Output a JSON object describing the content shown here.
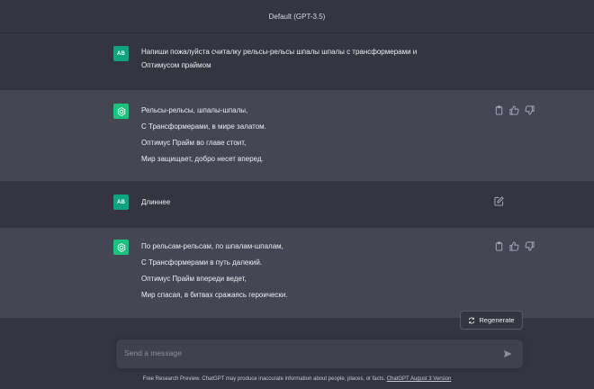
{
  "header": {
    "model_label": "Default (GPT-3.5)"
  },
  "conversation": [
    {
      "role": "user",
      "avatar": "AB",
      "lines": [
        "Напиши пожалуйста считалку рельсы-рельсы шпалы шпалы с трансформерами и",
        "Оптимусом праймом"
      ]
    },
    {
      "role": "assistant",
      "lines": [
        "Рельсы-рельсы, шпалы-шпалы,",
        "С Трансформерами, в мире залатом.",
        "Оптимус Прайм во главе стоит,",
        "Мир защищает, добро несет вперед."
      ]
    },
    {
      "role": "user",
      "avatar": "AB",
      "lines": [
        "Длиннее"
      ]
    },
    {
      "role": "assistant",
      "lines": [
        "По рельсам-рельсам, по шпалам-шпалам,",
        "С Трансформерами в путь далекий.",
        "Оптимус Прайм впереди ведет,",
        "Мир спасая, в битвах сражаясь героически."
      ]
    }
  ],
  "regenerate_label": "Regenerate",
  "input": {
    "placeholder": "Send a message"
  },
  "footer": {
    "text": "Free Research Preview. ChatGPT may produce inaccurate information about people, places, or facts.",
    "link": "ChatGPT August 3 Version"
  },
  "colors": {
    "accent": "#10a37f",
    "bot_avatar": "#19c37d",
    "background": "#343541",
    "bot_row": "#444654"
  }
}
